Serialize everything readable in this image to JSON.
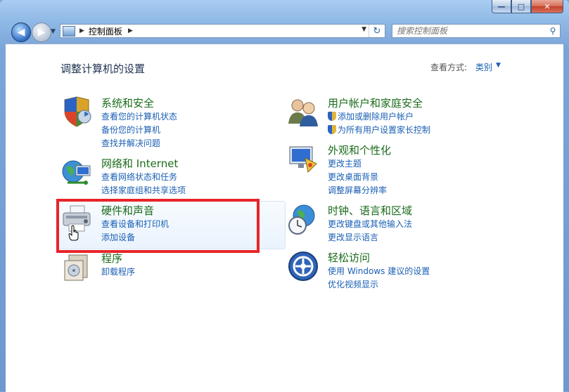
{
  "window": {
    "min": "—",
    "max": "□",
    "close": "✕"
  },
  "address": {
    "breadcrumb": "控制面板"
  },
  "search": {
    "placeholder": "搜索控制面板"
  },
  "page_title": "调整计算机的设置",
  "view_by": {
    "label": "查看方式:",
    "value": "类别"
  },
  "categories": [
    {
      "title": "系统和安全",
      "links": [
        "查看您的计算机状态",
        "备份您的计算机",
        "查找并解决问题"
      ]
    },
    {
      "title": "网络和 Internet",
      "links": [
        "查看网络状态和任务",
        "选择家庭组和共享选项"
      ]
    },
    {
      "title": "硬件和声音",
      "links": [
        "查看设备和打印机",
        "添加设备"
      ]
    },
    {
      "title": "程序",
      "links": [
        "卸载程序"
      ]
    },
    {
      "title": "用户帐户和家庭安全",
      "links": [
        "添加或删除用户帐户",
        "为所有用户设置家长控制"
      ]
    },
    {
      "title": "外观和个性化",
      "links": [
        "更改主题",
        "更改桌面背景",
        "调整屏幕分辨率"
      ]
    },
    {
      "title": "时钟、语言和区域",
      "links": [
        "更改键盘或其他输入法",
        "更改显示语言"
      ]
    },
    {
      "title": "轻松访问",
      "links": [
        "使用 Windows 建议的设置",
        "优化视频显示"
      ]
    }
  ],
  "colors": {
    "accent_link": "#1a5fb4",
    "category_title": "#1a6b1a",
    "highlight": "#e8242a"
  },
  "icons": [
    "back-icon",
    "forward-icon",
    "control-panel-icon",
    "refresh-icon",
    "search-icon",
    "shield-icon",
    "users-icon",
    "network-icon",
    "appearance-icon",
    "hardware-icon",
    "clock-globe-icon",
    "programs-icon",
    "ease-of-access-icon",
    "hand-cursor-icon"
  ]
}
